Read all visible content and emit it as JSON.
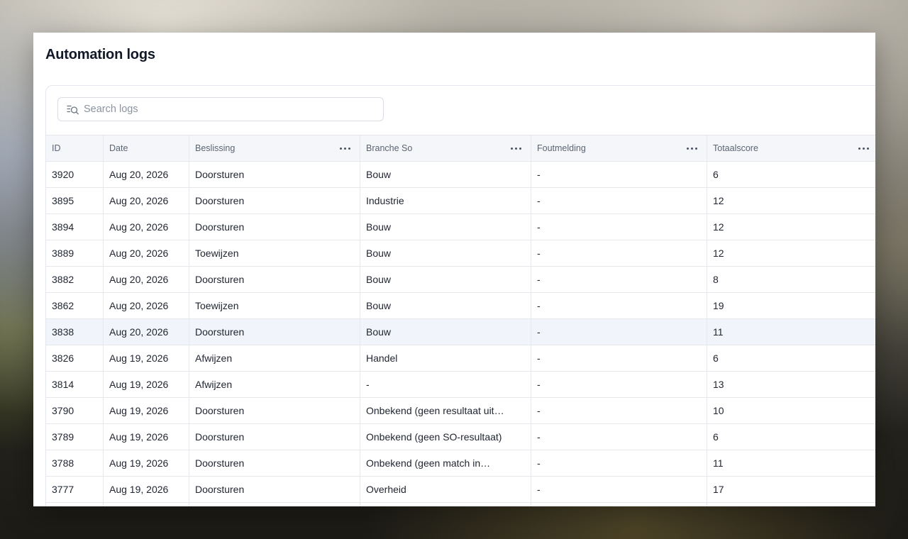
{
  "page": {
    "title": "Automation logs"
  },
  "search": {
    "placeholder": "Search logs",
    "value": ""
  },
  "columns": [
    "ID",
    "Date",
    "Beslissing",
    "Branche So",
    "Foutmelding",
    "Totaalscore"
  ],
  "rows": [
    [
      "3920",
      "Aug 20, 2026",
      "Doorsturen",
      "Bouw",
      "-",
      "6"
    ],
    [
      "3895",
      "Aug 20, 2026",
      "Doorsturen",
      "Industrie",
      "-",
      "12"
    ],
    [
      "3894",
      "Aug 20, 2026",
      "Doorsturen",
      "Bouw",
      "-",
      "12"
    ],
    [
      "3889",
      "Aug 20, 2026",
      "Toewijzen",
      "Bouw",
      "-",
      "12"
    ],
    [
      "3882",
      "Aug 20, 2026",
      "Doorsturen",
      "Bouw",
      "-",
      "8"
    ],
    [
      "3862",
      "Aug 20, 2026",
      "Toewijzen",
      "Bouw",
      "-",
      "19"
    ],
    [
      "3838",
      "Aug 20, 2026",
      "Doorsturen",
      "Bouw",
      "-",
      "11"
    ],
    [
      "3826",
      "Aug 19, 2026",
      "Afwijzen",
      "Handel",
      "-",
      "6"
    ],
    [
      "3814",
      "Aug 19, 2026",
      "Afwijzen",
      "-",
      "-",
      "13"
    ],
    [
      "3790",
      "Aug 19, 2026",
      "Doorsturen",
      "Onbekend (geen resultaat uit…",
      "-",
      "10"
    ],
    [
      "3789",
      "Aug 19, 2026",
      "Doorsturen",
      "Onbekend (geen SO-resultaat)",
      "-",
      "6"
    ],
    [
      "3788",
      "Aug 19, 2026",
      "Doorsturen",
      "Onbekend (geen match in…",
      "-",
      "11"
    ],
    [
      "3777",
      "Aug 19, 2026",
      "Doorsturen",
      "Overheid",
      "-",
      "17"
    ],
    [
      "",
      "",
      "",
      "",
      "",
      ""
    ]
  ],
  "colors": {
    "row_highlight": "#f1f4fa",
    "header_bg": "#f4f6f9",
    "border": "#e6e8ec"
  }
}
